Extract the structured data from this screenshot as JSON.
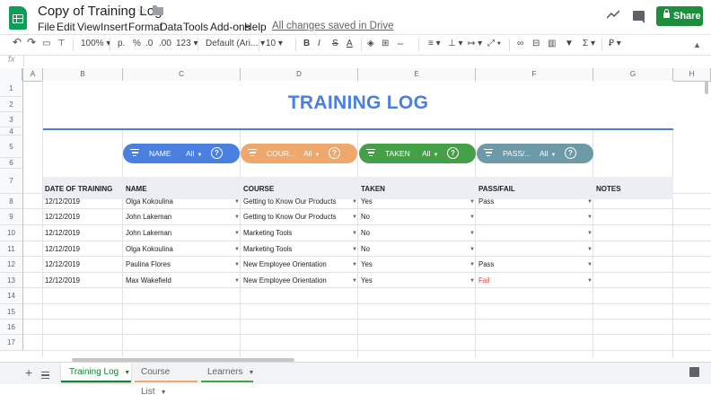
{
  "app": {
    "title": "Copy of Training Log",
    "save_status": "All changes saved in Drive",
    "share_label": "Share",
    "menu": [
      "File",
      "Edit",
      "View",
      "Insert",
      "Format",
      "Data",
      "Tools",
      "Add-ons",
      "Help"
    ]
  },
  "toolbar": {
    "zoom": "100%",
    "currency": "p.",
    "percent": "%",
    "decimal_dec": ".0",
    "decimal_inc": ".00",
    "format_more": "123",
    "font": "Default (Ari...",
    "font_size": "10",
    "bold": "B",
    "text_color": "A",
    "functions": "Σ"
  },
  "formula_bar": {
    "fx": "fx"
  },
  "columns": [
    "A",
    "B",
    "C",
    "D",
    "E",
    "F",
    "G",
    "H"
  ],
  "rows": [
    "1",
    "2",
    "3",
    "4",
    "5",
    "6",
    "7",
    "8",
    "9",
    "10",
    "11",
    "12",
    "13",
    "14",
    "15",
    "16",
    "17"
  ],
  "sheet": {
    "title": "TRAINING LOG",
    "filters": [
      {
        "label": "NAME",
        "value": "All",
        "color": "#4a7fe0"
      },
      {
        "label": "COUR...",
        "value": "All",
        "color": "#efa76b"
      },
      {
        "label": "TAKEN",
        "value": "All",
        "color": "#43a047"
      },
      {
        "label": "PASS/...",
        "value": "All",
        "color": "#6d9aa6"
      }
    ],
    "headers": [
      "DATE OF TRAINING",
      "NAME",
      "COURSE",
      "TAKEN",
      "PASS/FAIL",
      "NOTES"
    ],
    "records": [
      {
        "date": "12/12/2019",
        "name": "Olga Kokoulina",
        "course": "Getting to Know Our Products",
        "taken": "Yes",
        "result": "Pass"
      },
      {
        "date": "12/12/2019",
        "name": "John Lakeman",
        "course": "Getting to Know Our Products",
        "taken": "No",
        "result": ""
      },
      {
        "date": "12/12/2019",
        "name": "John Lakeman",
        "course": "Marketing Tools",
        "taken": "No",
        "result": ""
      },
      {
        "date": "12/12/2019",
        "name": "Olga Kokoulina",
        "course": "Marketing Tools",
        "taken": "No",
        "result": ""
      },
      {
        "date": "12/12/2019",
        "name": "Paulina Flores",
        "course": "New Employee Orientation",
        "taken": "Yes",
        "result": "Pass"
      },
      {
        "date": "12/12/2019",
        "name": "Max Wakefield",
        "course": "New Employee Orientation",
        "taken": "Yes",
        "result": "Fail"
      }
    ]
  },
  "tabs": [
    {
      "label": "Training Log",
      "active": true,
      "color": "#188038"
    },
    {
      "label": "Course List",
      "active": false,
      "color": "#efa76b"
    },
    {
      "label": "Learners",
      "active": false,
      "color": "#43a047"
    }
  ],
  "icons": [
    "sheets-logo-icon",
    "star-icon",
    "folder-icon",
    "trend-icon",
    "comment-icon",
    "lock-icon",
    "undo-icon",
    "redo-icon",
    "print-icon",
    "paint-format-icon",
    "filter-icon",
    "help-icon",
    "add-sheet-icon",
    "all-sheets-icon",
    "explore-icon"
  ]
}
